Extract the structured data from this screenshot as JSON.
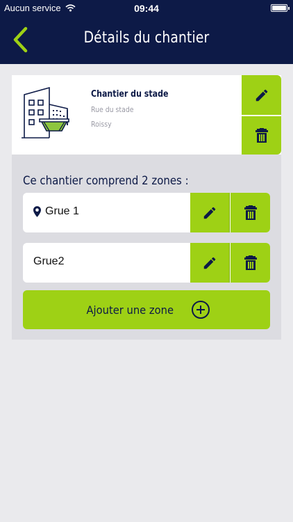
{
  "status_bar": {
    "carrier": "Aucun service",
    "time": "09:44"
  },
  "header": {
    "title": "Détails du chantier",
    "back_icon": "chevron-left-icon"
  },
  "site": {
    "name": "Chantier du stade",
    "street": "Rue du stade",
    "city": "Roissy",
    "icon": "construction-site-icon"
  },
  "zones": {
    "heading": "Ce chantier comprend 2 zones :",
    "items": [
      {
        "label": "Grue 1",
        "has_location": true
      },
      {
        "label": "Grue2",
        "has_location": false
      }
    ],
    "add_label": "Ajouter une zone"
  },
  "colors": {
    "navy": "#0d1a47",
    "accent": "#9ed115",
    "background": "#eaeaed",
    "panel": "#dcdce1"
  }
}
